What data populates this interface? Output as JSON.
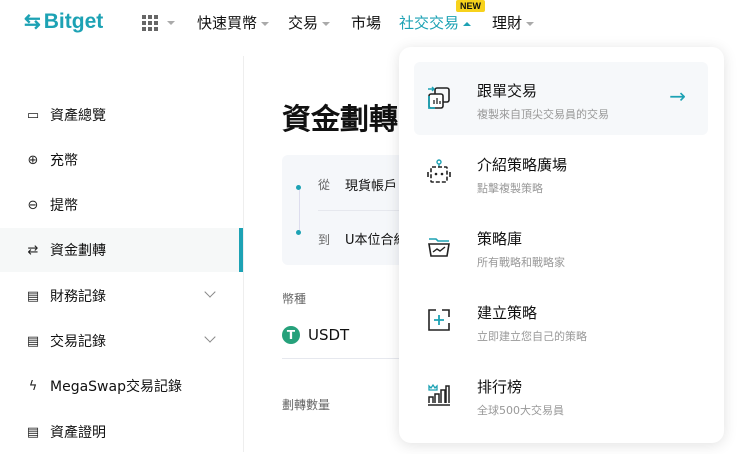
{
  "header": {
    "logo": "Bitget",
    "nav": [
      {
        "label": "快速買幣"
      },
      {
        "label": "交易"
      },
      {
        "label": "市場"
      },
      {
        "label": "社交交易",
        "badge": "NEW"
      },
      {
        "label": "理財"
      }
    ]
  },
  "sidebar": {
    "items": [
      {
        "label": "資產總覽",
        "icon": "wallet-icon"
      },
      {
        "label": "充幣",
        "icon": "deposit-icon"
      },
      {
        "label": "提幣",
        "icon": "withdraw-icon"
      },
      {
        "label": "資金劃轉",
        "icon": "transfer-icon",
        "active": true
      },
      {
        "label": "財務記錄",
        "icon": "record-icon",
        "expandable": true
      },
      {
        "label": "交易記錄",
        "icon": "trade-record-icon",
        "expandable": true
      },
      {
        "label": "MegaSwap交易記錄",
        "icon": "megaswap-icon"
      },
      {
        "label": "資產證明",
        "icon": "proof-icon"
      }
    ]
  },
  "main": {
    "title": "資金劃轉",
    "from_label": "從",
    "from_value": "現貨帳戶",
    "to_label": "到",
    "to_value": "U本位合約",
    "coin_label": "幣種",
    "coin": "USDT",
    "amount_label": "劃轉數量"
  },
  "dropdown": {
    "items": [
      {
        "title": "跟單交易",
        "desc": "複製來自頂尖交易員的交易"
      },
      {
        "title": "介紹策略廣場",
        "desc": "點擊複製策略"
      },
      {
        "title": "策略庫",
        "desc": "所有戰略和戰略家"
      },
      {
        "title": "建立策略",
        "desc": "立即建立您自己的策略"
      },
      {
        "title": "排行榜",
        "desc": "全球500大交易員"
      }
    ]
  },
  "colors": {
    "accent": "#1da2b4",
    "badge": "#f7d21c",
    "usdt": "#26a17b"
  }
}
